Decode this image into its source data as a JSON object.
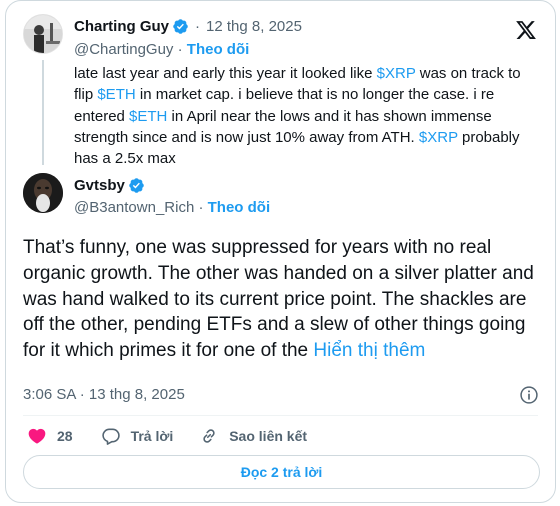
{
  "quoted": {
    "author_name": "Charting Guy",
    "date": "12 thg 8, 2025",
    "handle": "@ChartingGuy",
    "separator": "·",
    "follow_label": "Theo dõi",
    "text_parts": [
      {
        "text": "late last year and early this year it looked like ",
        "type": "text"
      },
      {
        "text": "$XRP",
        "type": "cashtag"
      },
      {
        "text": " was on track to flip ",
        "type": "text"
      },
      {
        "text": "$ETH",
        "type": "cashtag"
      },
      {
        "text": " in market cap. i believe that is no longer the case. i re entered ",
        "type": "text"
      },
      {
        "text": "$ETH",
        "type": "cashtag"
      },
      {
        "text": " in April near the lows and it has shown immense strength since and is now just 10% away from ATH. ",
        "type": "text"
      },
      {
        "text": "$XRP",
        "type": "cashtag"
      },
      {
        "text": " probably has a 2.5x max",
        "type": "text"
      }
    ]
  },
  "tweet": {
    "author_name": "Gvtsby",
    "handle": "@B3antown_Rich",
    "separator": "·",
    "follow_label": "Theo dõi",
    "text": "That’s funny, one was suppressed for years with no real organic growth. The other was handed on a silver platter and was hand walked to its current price point. The shackles are off the other, pending ETFs and a slew of other things going for it which primes it for one of the",
    "show_more": "Hiển thị thêm",
    "timestamp": "3:06 SA · 13 thg 8, 2025"
  },
  "actions": {
    "like_count": "28",
    "reply_label": "Trả lời",
    "copy_link_label": "Sao liên kết"
  },
  "read_replies_button": "Đọc 2 trả lời",
  "icons": {
    "logo": "x-logo-icon",
    "verified": "verified-badge-icon",
    "info": "info-icon",
    "like": "heart-icon",
    "reply": "reply-bubble-icon",
    "link": "link-icon"
  },
  "colors": {
    "accent": "#1d9bf0",
    "like": "#f91880",
    "muted": "#536471",
    "text": "#0f1419",
    "border": "#cfd9de"
  }
}
